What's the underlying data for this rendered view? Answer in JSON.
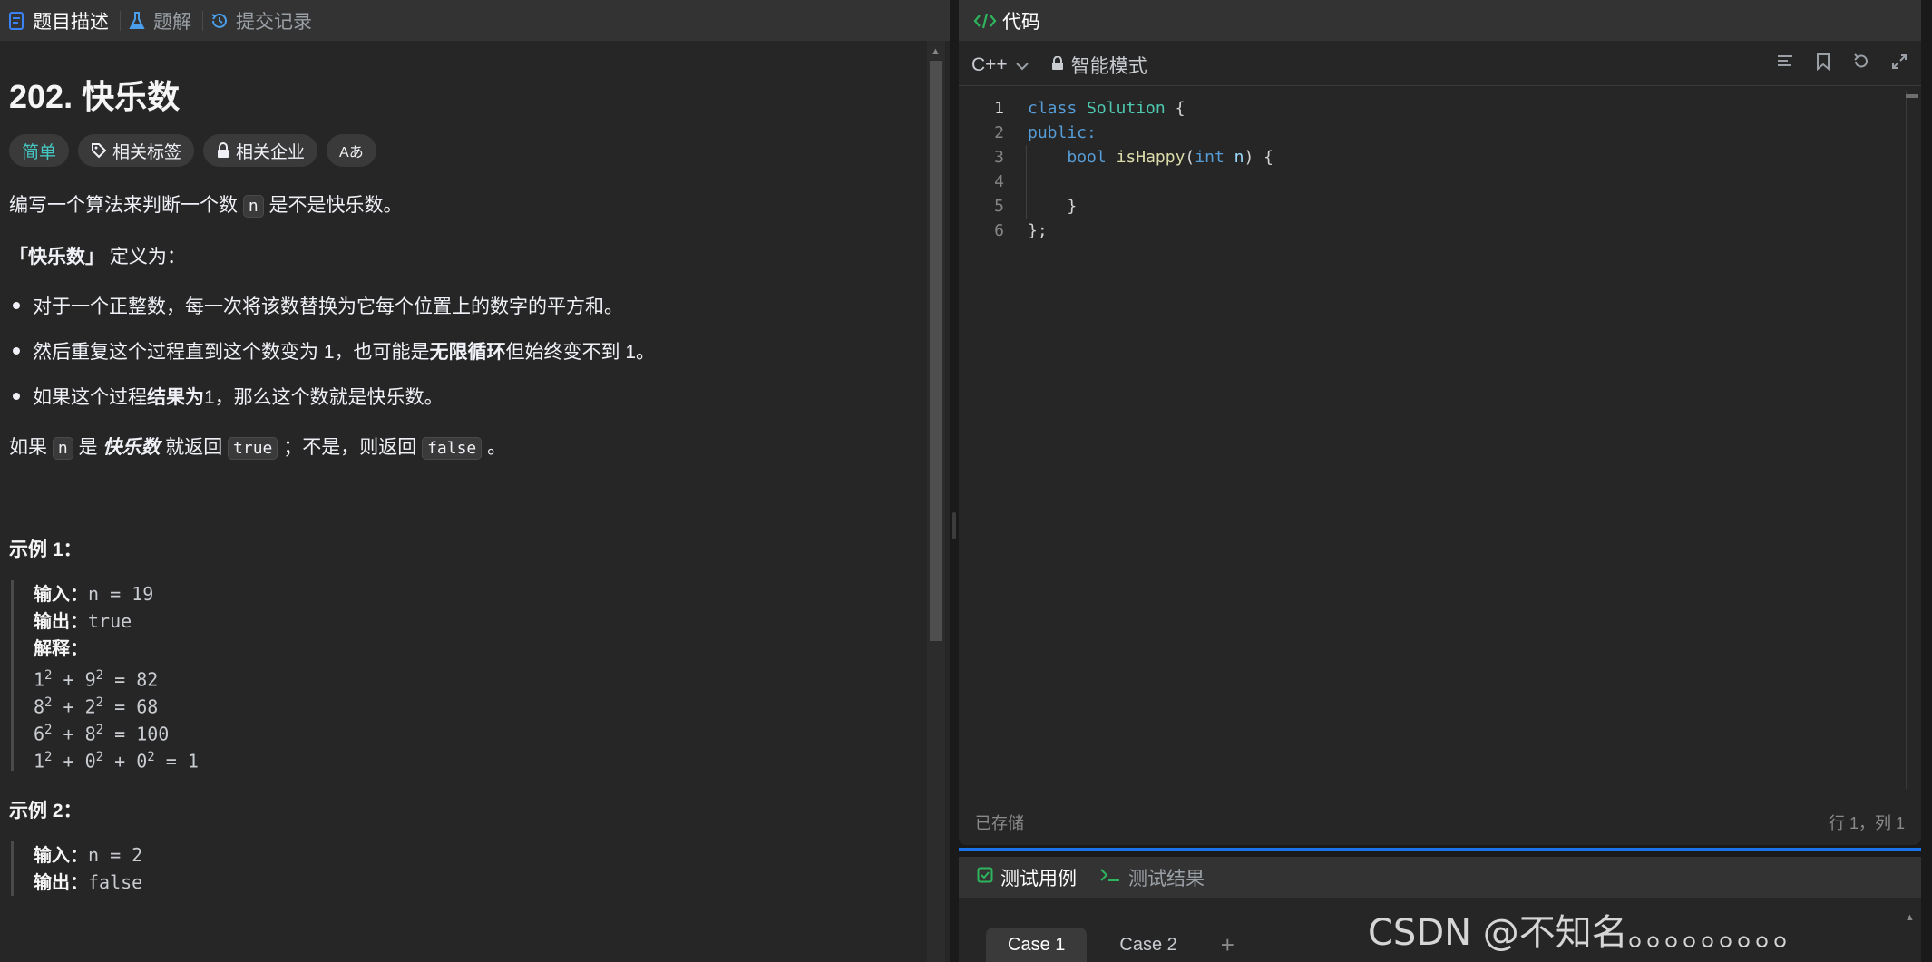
{
  "left_tabs": [
    {
      "label": "题目描述",
      "icon": "description-icon"
    },
    {
      "label": "题解",
      "icon": "flask-icon"
    },
    {
      "label": "提交记录",
      "icon": "history-icon"
    }
  ],
  "problem": {
    "title": "202. 快乐数",
    "tags": {
      "difficulty": "简单",
      "related_tags": "相关标签",
      "related_companies": "相关企业",
      "translate": "Aあ"
    },
    "intro_1": "编写一个算法来判断一个数 ",
    "intro_code": "n",
    "intro_2": " 是不是快乐数。",
    "def_bold": "「快乐数」",
    "def_rest": " 定义为：",
    "bullets": [
      {
        "pre": "对于一个正整数，每一次将该数替换为它每个位置上的数字的平方和。",
        "bold": "",
        "post": ""
      },
      {
        "pre": "然后重复这个过程直到这个数变为 1，也可能是 ",
        "bold": "无限循环",
        "post": " 但始终变不到 1。"
      },
      {
        "pre": "如果这个过程 ",
        "bold": "结果为",
        "post": " 1，那么这个数就是快乐数。"
      }
    ],
    "return_1": "如果 ",
    "return_code_n": "n",
    "return_2": " 是 ",
    "return_bold": "快乐数",
    "return_3": " 就返回 ",
    "return_code_true": "true",
    "return_4": " ；不是，则返回 ",
    "return_code_false": "false",
    "return_5": " 。",
    "example1": {
      "title": "示例 1：",
      "input_label": "输入：",
      "input": "n = 19",
      "output_label": "输出：",
      "output": "true",
      "explain_label": "解释：",
      "lines": [
        [
          "1",
          "2",
          " + 9",
          "2",
          " = 82"
        ],
        [
          "8",
          "2",
          " + 2",
          "2",
          " = 68"
        ],
        [
          "6",
          "2",
          " + 8",
          "2",
          " = 100"
        ]
      ],
      "last_line": [
        "1",
        "2",
        " + 0",
        "2",
        " + 0",
        "2",
        " = 1"
      ]
    },
    "example2": {
      "title": "示例 2：",
      "input_label": "输入：",
      "input": "n = 2",
      "output_label": "输出：",
      "output": "false"
    }
  },
  "editor": {
    "header": "代码",
    "language": "C++",
    "mode": "智能模式",
    "status_left": "已存储",
    "status_right": "行 1，列 1",
    "lines": [
      {
        "n": "1"
      },
      {
        "n": "2"
      },
      {
        "n": "3"
      },
      {
        "n": "4"
      },
      {
        "n": "5"
      },
      {
        "n": "6"
      }
    ],
    "code": {
      "l1_kw": "class",
      "l1_cls": "Solution",
      "l1_end": " {",
      "l2": "public:",
      "l3_indent": "    ",
      "l3_kw": "bool",
      "l3_fn": "isHappy",
      "l3_open": "(",
      "l3_kw2": "int",
      "l3_var": "n",
      "l3_end": ") {",
      "l5": "    }",
      "l6": "};"
    }
  },
  "test": {
    "tab_cases": "测试用例",
    "tab_results": "测试结果",
    "cases": [
      "Case 1",
      "Case 2"
    ],
    "add": "+"
  },
  "watermark": "CSDN @不知名。。。。。。。。。",
  "colors": {
    "accent": "#1a73e8",
    "easy": "#46c6c2",
    "code_tag_green": "#2db55d"
  }
}
